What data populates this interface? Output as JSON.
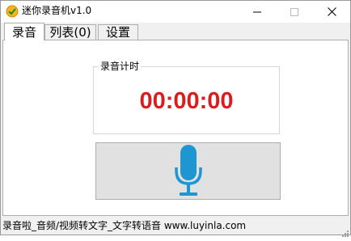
{
  "window": {
    "title": "迷你录音机v1.0",
    "app_icon": "check-shield-icon",
    "controls": {
      "minimize_icon": "minimize-icon",
      "maximize_icon": "maximize-icon",
      "close_icon": "close-icon"
    }
  },
  "tabs": [
    {
      "label": "录音",
      "active": true
    },
    {
      "label": "列表(0)",
      "active": false
    },
    {
      "label": "设置",
      "active": false
    }
  ],
  "recording": {
    "group_label": "录音计时",
    "timer": "00:00:00",
    "record_button_icon": "microphone-icon"
  },
  "statusbar": {
    "text": "录音啦_音频/视频转文字_文字转语音 www.luyinla.com"
  },
  "colors": {
    "timer": "#d71f1f",
    "microphone": "#1e96d2",
    "app_icon": "#e8a21a"
  }
}
